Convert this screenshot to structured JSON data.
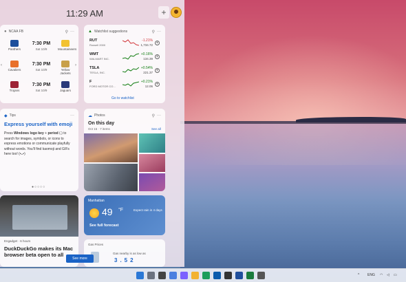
{
  "clock": "11:29 AM",
  "sports": {
    "league": "NCAA FB",
    "games": [
      {
        "team1": "Panthers",
        "team2": "Mountaineers",
        "time": "7:30 PM",
        "date": "Sat 10/9"
      },
      {
        "team1": "Cavaliers",
        "team2": "Yellow Jackets",
        "time": "7:30 PM",
        "date": "Sat 10/9"
      },
      {
        "team1": "Trojans",
        "team2": "Jaguars",
        "time": "7:30 PM",
        "date": "Sat 10/9"
      }
    ]
  },
  "watchlist": {
    "title": "Watchlist suggestions",
    "stocks": [
      {
        "symbol": "RUT",
        "name": "Russell 2000",
        "change": "-1.21%",
        "price": "1,734.72",
        "trend": "down"
      },
      {
        "symbol": "WMT",
        "name": "WALMART INC.",
        "change": "+0.16%",
        "price": "134.39",
        "trend": "up"
      },
      {
        "symbol": "TSLA",
        "name": "TESLA, INC.",
        "change": "+0.54%",
        "price": "221.37",
        "trend": "up"
      },
      {
        "symbol": "F",
        "name": "FORD MOTOR CO...",
        "change": "+0.21%",
        "price": "12.06",
        "trend": "up"
      }
    ],
    "link": "Go to watchlist"
  },
  "tips": {
    "label": "Tips",
    "title": "Express yourself with emoji",
    "body_1": "Press ",
    "body_bold": "Windows logo key",
    "body_2": " + ",
    "body_bold_2": "period",
    "body_3": " (.) to search for images, symbols, or icons to express emotions or communicate playfully without words. You'll find kaomoji and GIFs here too! (•ᴗ•)"
  },
  "photos": {
    "label": "Photos",
    "title": "On this day",
    "subtitle": "Oct 15 · 7 items",
    "see_all": "See all"
  },
  "news": {
    "source": "Engadget · 6 hours",
    "title": "DuckDuckGo makes its Mac browser beta open to all"
  },
  "weather": {
    "location": "Manhattan",
    "temp": "49",
    "unit": "°F",
    "note": "Expect rain in 4 days",
    "link": "See full forecast"
  },
  "gas": {
    "label": "Gas Prices",
    "text": "Gas nearby is as low as",
    "price": "3.52"
  },
  "see_more": "See more",
  "tray": {
    "lang": "ENG"
  },
  "colors": {
    "accent": "#1a63c6",
    "down": "#d13438",
    "up": "#107c10"
  }
}
